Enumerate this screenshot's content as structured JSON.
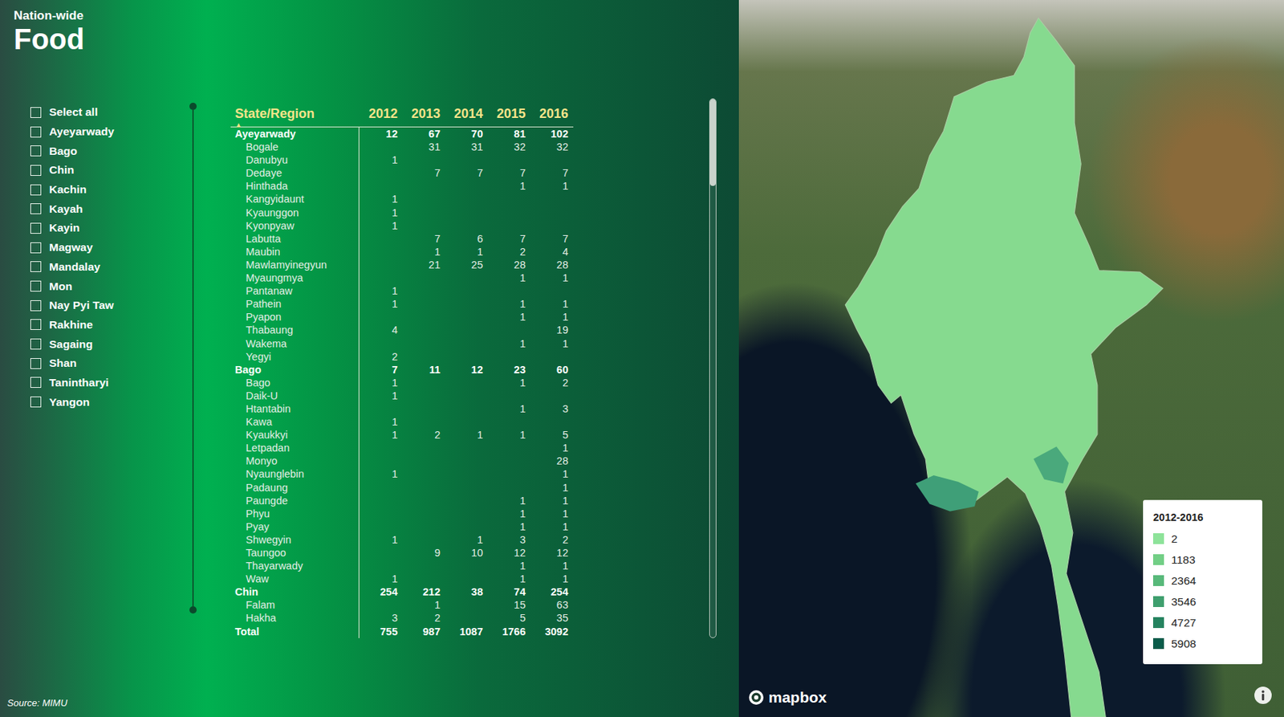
{
  "header": {
    "subtitle": "Nation-wide",
    "title": "Food"
  },
  "filters": [
    {
      "label": "Select all",
      "checked": false
    },
    {
      "label": "Ayeyarwady",
      "checked": false
    },
    {
      "label": "Bago",
      "checked": false
    },
    {
      "label": "Chin",
      "checked": false
    },
    {
      "label": "Kachin",
      "checked": false
    },
    {
      "label": "Kayah",
      "checked": false
    },
    {
      "label": "Kayin",
      "checked": false
    },
    {
      "label": "Magway",
      "checked": false
    },
    {
      "label": "Mandalay",
      "checked": false
    },
    {
      "label": "Mon",
      "checked": false
    },
    {
      "label": "Nay Pyi Taw",
      "checked": false
    },
    {
      "label": "Rakhine",
      "checked": false
    },
    {
      "label": "Sagaing",
      "checked": false
    },
    {
      "label": "Shan",
      "checked": false
    },
    {
      "label": "Tanintharyi",
      "checked": false
    },
    {
      "label": "Yangon",
      "checked": false
    }
  ],
  "table": {
    "columns": [
      "State/Region",
      "2012",
      "2013",
      "2014",
      "2015",
      "2016"
    ],
    "sort_icon": "▲",
    "rows": [
      {
        "kind": "region",
        "name": "Ayeyarwady",
        "values": [
          "12",
          "67",
          "70",
          "81",
          "102"
        ]
      },
      {
        "kind": "district",
        "name": "Bogale",
        "values": [
          "",
          "31",
          "31",
          "32",
          "32"
        ]
      },
      {
        "kind": "district",
        "name": "Danubyu",
        "values": [
          "1",
          "",
          "",
          "",
          ""
        ]
      },
      {
        "kind": "district",
        "name": "Dedaye",
        "values": [
          "",
          "7",
          "7",
          "7",
          "7"
        ]
      },
      {
        "kind": "district",
        "name": "Hinthada",
        "values": [
          "",
          "",
          "",
          "1",
          "1"
        ]
      },
      {
        "kind": "district",
        "name": "Kangyidaunt",
        "values": [
          "1",
          "",
          "",
          "",
          ""
        ]
      },
      {
        "kind": "district",
        "name": "Kyaunggon",
        "values": [
          "1",
          "",
          "",
          "",
          ""
        ]
      },
      {
        "kind": "district",
        "name": "Kyonpyaw",
        "values": [
          "1",
          "",
          "",
          "",
          ""
        ]
      },
      {
        "kind": "district",
        "name": "Labutta",
        "values": [
          "",
          "7",
          "6",
          "7",
          "7"
        ]
      },
      {
        "kind": "district",
        "name": "Maubin",
        "values": [
          "",
          "1",
          "1",
          "2",
          "4"
        ]
      },
      {
        "kind": "district",
        "name": "Mawlamyinegyun",
        "values": [
          "",
          "21",
          "25",
          "28",
          "28"
        ]
      },
      {
        "kind": "district",
        "name": "Myaungmya",
        "values": [
          "",
          "",
          "",
          "1",
          "1"
        ]
      },
      {
        "kind": "district",
        "name": "Pantanaw",
        "values": [
          "1",
          "",
          "",
          "",
          ""
        ]
      },
      {
        "kind": "district",
        "name": "Pathein",
        "values": [
          "1",
          "",
          "",
          "1",
          "1"
        ]
      },
      {
        "kind": "district",
        "name": "Pyapon",
        "values": [
          "",
          "",
          "",
          "1",
          "1"
        ]
      },
      {
        "kind": "district",
        "name": "Thabaung",
        "values": [
          "4",
          "",
          "",
          "",
          "19"
        ]
      },
      {
        "kind": "district",
        "name": "Wakema",
        "values": [
          "",
          "",
          "",
          "1",
          "1"
        ]
      },
      {
        "kind": "district",
        "name": "Yegyi",
        "values": [
          "2",
          "",
          "",
          "",
          ""
        ]
      },
      {
        "kind": "region",
        "name": "Bago",
        "values": [
          "7",
          "11",
          "12",
          "23",
          "60"
        ]
      },
      {
        "kind": "district",
        "name": "Bago",
        "values": [
          "1",
          "",
          "",
          "1",
          "2"
        ]
      },
      {
        "kind": "district",
        "name": "Daik-U",
        "values": [
          "1",
          "",
          "",
          "",
          ""
        ]
      },
      {
        "kind": "district",
        "name": "Htantabin",
        "values": [
          "",
          "",
          "",
          "1",
          "3"
        ]
      },
      {
        "kind": "district",
        "name": "Kawa",
        "values": [
          "1",
          "",
          "",
          "",
          ""
        ]
      },
      {
        "kind": "district",
        "name": "Kyaukkyi",
        "values": [
          "1",
          "2",
          "1",
          "1",
          "5"
        ]
      },
      {
        "kind": "district",
        "name": "Letpadan",
        "values": [
          "",
          "",
          "",
          "",
          "1"
        ]
      },
      {
        "kind": "district",
        "name": "Monyo",
        "values": [
          "",
          "",
          "",
          "",
          "28"
        ]
      },
      {
        "kind": "district",
        "name": "Nyaunglebin",
        "values": [
          "1",
          "",
          "",
          "",
          "1"
        ]
      },
      {
        "kind": "district",
        "name": "Padaung",
        "values": [
          "",
          "",
          "",
          "",
          "1"
        ]
      },
      {
        "kind": "district",
        "name": "Paungde",
        "values": [
          "",
          "",
          "",
          "1",
          "1"
        ]
      },
      {
        "kind": "district",
        "name": "Phyu",
        "values": [
          "",
          "",
          "",
          "1",
          "1"
        ]
      },
      {
        "kind": "district",
        "name": "Pyay",
        "values": [
          "",
          "",
          "",
          "1",
          "1"
        ]
      },
      {
        "kind": "district",
        "name": "Shwegyin",
        "values": [
          "1",
          "",
          "1",
          "3",
          "2"
        ]
      },
      {
        "kind": "district",
        "name": "Taungoo",
        "values": [
          "",
          "9",
          "10",
          "12",
          "12"
        ]
      },
      {
        "kind": "district",
        "name": "Thayarwady",
        "values": [
          "",
          "",
          "",
          "1",
          "1"
        ]
      },
      {
        "kind": "district",
        "name": "Waw",
        "values": [
          "1",
          "",
          "",
          "1",
          "1"
        ]
      },
      {
        "kind": "region",
        "name": "Chin",
        "values": [
          "254",
          "212",
          "38",
          "74",
          "254"
        ]
      },
      {
        "kind": "district",
        "name": "Falam",
        "values": [
          "",
          "1",
          "",
          "15",
          "63"
        ]
      },
      {
        "kind": "district",
        "name": "Hakha",
        "values": [
          "3",
          "2",
          "",
          "5",
          "35"
        ]
      },
      {
        "kind": "total",
        "name": "Total",
        "values": [
          "755",
          "987",
          "1087",
          "1766",
          "3092"
        ]
      }
    ]
  },
  "source": "Source: MIMU",
  "legend": {
    "title": "2012-2016",
    "items": [
      {
        "label": "2",
        "color": "#8ee39a"
      },
      {
        "label": "1183",
        "color": "#72cf86"
      },
      {
        "label": "2364",
        "color": "#58b97a"
      },
      {
        "label": "3546",
        "color": "#3f9f6e"
      },
      {
        "label": "4727",
        "color": "#25835f"
      },
      {
        "label": "5908",
        "color": "#0b5c4a"
      }
    ]
  },
  "map": {
    "attribution": "mapbox"
  }
}
